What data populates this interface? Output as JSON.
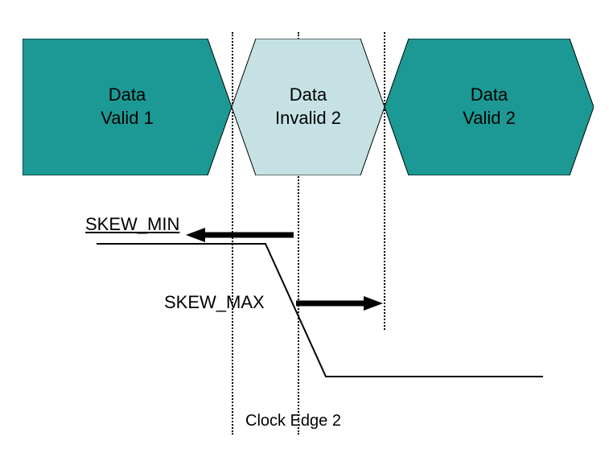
{
  "diagram": {
    "data_blocks": [
      {
        "label": "Data\nValid 1",
        "color": "dark"
      },
      {
        "label": "Data\nInvalid 2",
        "color": "light"
      },
      {
        "label": "Data\nValid 2",
        "color": "dark"
      }
    ],
    "skew_min_label": "SKEW_MIN",
    "skew_max_label": "SKEW_MAX",
    "clock_edge_label": "Clock Edge 2",
    "colors": {
      "dark_fill": "#1c9994",
      "light_fill": "#c5e1e4"
    }
  }
}
